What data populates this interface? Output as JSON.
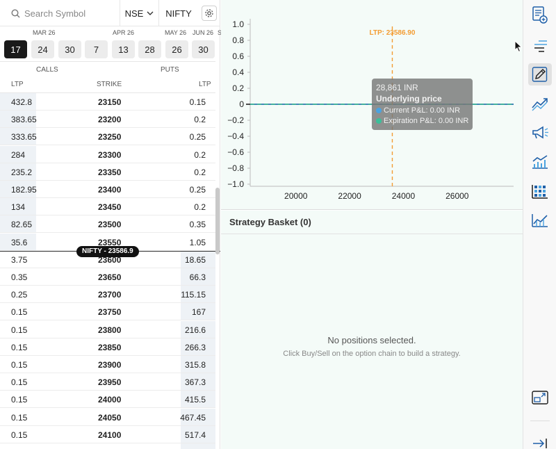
{
  "search": {
    "placeholder": "Search Symbol"
  },
  "exchange": {
    "value": "NSE"
  },
  "symbol": {
    "value": "NIFTY"
  },
  "months": [
    {
      "label": "MAR 26"
    },
    {
      "label": "APR 26"
    },
    {
      "label": "MAY 26"
    },
    {
      "label": "JUN 26"
    },
    {
      "label": "S"
    }
  ],
  "dates": [
    {
      "label": "17",
      "selected": true
    },
    {
      "label": "24",
      "selected": false
    },
    {
      "label": "30",
      "selected": false
    },
    {
      "label": "7",
      "selected": false
    },
    {
      "label": "13",
      "selected": false
    },
    {
      "label": "28",
      "selected": false
    },
    {
      "label": "26",
      "selected": false
    },
    {
      "label": "30",
      "selected": false
    }
  ],
  "chain": {
    "calls_header": "CALLS",
    "puts_header": "PUTS",
    "col_ltp_call": "LTP",
    "col_strike": "STRIKE",
    "col_ltp_put": "LTP",
    "spot_label": "NIFTY - 23586.9",
    "rows": [
      {
        "call": "432.8",
        "strike": "23150",
        "put": "0.15"
      },
      {
        "call": "383.65",
        "strike": "23200",
        "put": "0.2"
      },
      {
        "call": "333.65",
        "strike": "23250",
        "put": "0.25"
      },
      {
        "call": "284",
        "strike": "23300",
        "put": "0.2"
      },
      {
        "call": "235.2",
        "strike": "23350",
        "put": "0.2"
      },
      {
        "call": "182.95",
        "strike": "23400",
        "put": "0.25"
      },
      {
        "call": "134",
        "strike": "23450",
        "put": "0.2"
      },
      {
        "call": "82.65",
        "strike": "23500",
        "put": "0.35"
      },
      {
        "call": "35.6",
        "strike": "23550",
        "put": "1.05"
      },
      {
        "call": "3.75",
        "strike": "23600",
        "put": "18.65"
      },
      {
        "call": "0.35",
        "strike": "23650",
        "put": "66.3"
      },
      {
        "call": "0.25",
        "strike": "23700",
        "put": "115.15"
      },
      {
        "call": "0.15",
        "strike": "23750",
        "put": "167"
      },
      {
        "call": "0.15",
        "strike": "23800",
        "put": "216.6"
      },
      {
        "call": "0.15",
        "strike": "23850",
        "put": "266.3"
      },
      {
        "call": "0.15",
        "strike": "23900",
        "put": "315.8"
      },
      {
        "call": "0.15",
        "strike": "23950",
        "put": "367.3"
      },
      {
        "call": "0.15",
        "strike": "24000",
        "put": "415.5"
      },
      {
        "call": "0.15",
        "strike": "24050",
        "put": "467.45"
      },
      {
        "call": "0.15",
        "strike": "24100",
        "put": "517.4"
      },
      {
        "call": "",
        "strike": "",
        "put": ""
      }
    ]
  },
  "chart_data": {
    "type": "line",
    "title": "",
    "xlabel": "",
    "ylabel": "",
    "xlim": [
      18300,
      28100
    ],
    "ylim": [
      -1.0,
      1.0
    ],
    "xticks": [
      20000,
      22000,
      24000,
      26000
    ],
    "yticks": [
      1.0,
      0.8,
      0.6,
      0.4,
      0.2,
      0,
      -0.2,
      -0.4,
      -0.6,
      -0.8,
      -1.0
    ],
    "ytick_labels": [
      "1.0",
      "0.8",
      "0.6",
      "0.4",
      "0.2",
      "0",
      "−0.2",
      "−0.4",
      "−0.6",
      "−0.8",
      "−1.0"
    ],
    "x": [
      18300,
      28100
    ],
    "series": [
      {
        "values": [
          0,
          0
        ],
        "color": "#2f86c9"
      },
      {
        "values": [
          0,
          0
        ],
        "color": "#3bbf9a",
        "dashed": true
      }
    ],
    "ltp": {
      "value": 23586.9,
      "label": "LTP: 23586.90",
      "color": "#f39c33"
    },
    "grid": false
  },
  "tooltip": {
    "price": "28,861 INR",
    "label": "Underlying price",
    "current": "Current P&L: 0.00 INR",
    "expiration": "Expiration P&L: 0.00 INR",
    "current_color": "#4aa3e0",
    "expiration_color": "#3bbf9a"
  },
  "basket": {
    "title": "Strategy Basket (0)",
    "empty_title": "No positions selected.",
    "empty_sub": "Click Buy/Sell on the option chain to build a strategy."
  },
  "rightbar": [
    {
      "icon": "add-document-icon"
    },
    {
      "icon": "sort-lines-icon"
    },
    {
      "icon": "pencil-icon",
      "active": true
    },
    {
      "icon": "trend-chart-icon"
    },
    {
      "icon": "megaphone-icon"
    },
    {
      "icon": "bar-trend-icon"
    },
    {
      "icon": "grid-chart-icon"
    },
    {
      "icon": "area-trend-icon"
    },
    {
      "icon": "popout-icon"
    },
    {
      "icon": "exit-icon"
    }
  ]
}
